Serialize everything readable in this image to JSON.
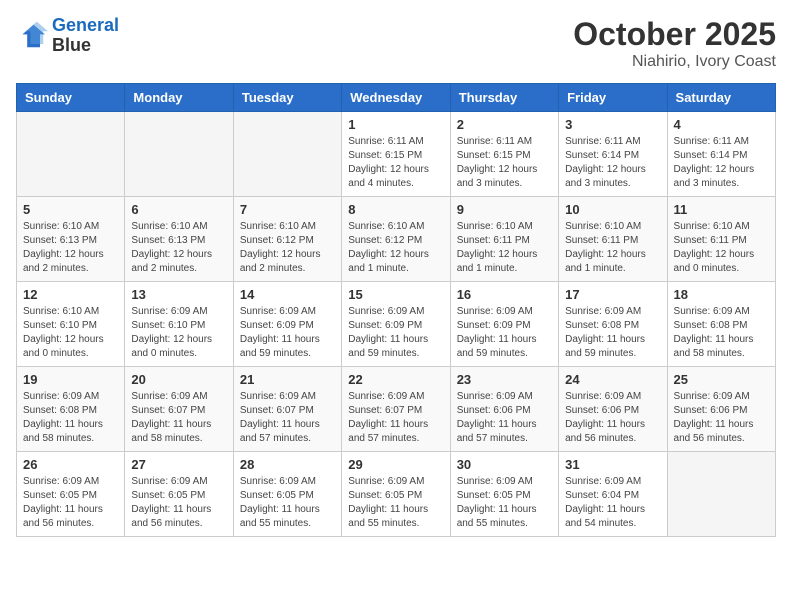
{
  "header": {
    "logo_line1": "General",
    "logo_line2": "Blue",
    "title": "October 2025",
    "subtitle": "Niahirio, Ivory Coast"
  },
  "weekdays": [
    "Sunday",
    "Monday",
    "Tuesday",
    "Wednesday",
    "Thursday",
    "Friday",
    "Saturday"
  ],
  "weeks": [
    [
      {
        "day": "",
        "info": ""
      },
      {
        "day": "",
        "info": ""
      },
      {
        "day": "",
        "info": ""
      },
      {
        "day": "1",
        "info": "Sunrise: 6:11 AM\nSunset: 6:15 PM\nDaylight: 12 hours\nand 4 minutes."
      },
      {
        "day": "2",
        "info": "Sunrise: 6:11 AM\nSunset: 6:15 PM\nDaylight: 12 hours\nand 3 minutes."
      },
      {
        "day": "3",
        "info": "Sunrise: 6:11 AM\nSunset: 6:14 PM\nDaylight: 12 hours\nand 3 minutes."
      },
      {
        "day": "4",
        "info": "Sunrise: 6:11 AM\nSunset: 6:14 PM\nDaylight: 12 hours\nand 3 minutes."
      }
    ],
    [
      {
        "day": "5",
        "info": "Sunrise: 6:10 AM\nSunset: 6:13 PM\nDaylight: 12 hours\nand 2 minutes."
      },
      {
        "day": "6",
        "info": "Sunrise: 6:10 AM\nSunset: 6:13 PM\nDaylight: 12 hours\nand 2 minutes."
      },
      {
        "day": "7",
        "info": "Sunrise: 6:10 AM\nSunset: 6:12 PM\nDaylight: 12 hours\nand 2 minutes."
      },
      {
        "day": "8",
        "info": "Sunrise: 6:10 AM\nSunset: 6:12 PM\nDaylight: 12 hours\nand 1 minute."
      },
      {
        "day": "9",
        "info": "Sunrise: 6:10 AM\nSunset: 6:11 PM\nDaylight: 12 hours\nand 1 minute."
      },
      {
        "day": "10",
        "info": "Sunrise: 6:10 AM\nSunset: 6:11 PM\nDaylight: 12 hours\nand 1 minute."
      },
      {
        "day": "11",
        "info": "Sunrise: 6:10 AM\nSunset: 6:11 PM\nDaylight: 12 hours\nand 0 minutes."
      }
    ],
    [
      {
        "day": "12",
        "info": "Sunrise: 6:10 AM\nSunset: 6:10 PM\nDaylight: 12 hours\nand 0 minutes."
      },
      {
        "day": "13",
        "info": "Sunrise: 6:09 AM\nSunset: 6:10 PM\nDaylight: 12 hours\nand 0 minutes."
      },
      {
        "day": "14",
        "info": "Sunrise: 6:09 AM\nSunset: 6:09 PM\nDaylight: 11 hours\nand 59 minutes."
      },
      {
        "day": "15",
        "info": "Sunrise: 6:09 AM\nSunset: 6:09 PM\nDaylight: 11 hours\nand 59 minutes."
      },
      {
        "day": "16",
        "info": "Sunrise: 6:09 AM\nSunset: 6:09 PM\nDaylight: 11 hours\nand 59 minutes."
      },
      {
        "day": "17",
        "info": "Sunrise: 6:09 AM\nSunset: 6:08 PM\nDaylight: 11 hours\nand 59 minutes."
      },
      {
        "day": "18",
        "info": "Sunrise: 6:09 AM\nSunset: 6:08 PM\nDaylight: 11 hours\nand 58 minutes."
      }
    ],
    [
      {
        "day": "19",
        "info": "Sunrise: 6:09 AM\nSunset: 6:08 PM\nDaylight: 11 hours\nand 58 minutes."
      },
      {
        "day": "20",
        "info": "Sunrise: 6:09 AM\nSunset: 6:07 PM\nDaylight: 11 hours\nand 58 minutes."
      },
      {
        "day": "21",
        "info": "Sunrise: 6:09 AM\nSunset: 6:07 PM\nDaylight: 11 hours\nand 57 minutes."
      },
      {
        "day": "22",
        "info": "Sunrise: 6:09 AM\nSunset: 6:07 PM\nDaylight: 11 hours\nand 57 minutes."
      },
      {
        "day": "23",
        "info": "Sunrise: 6:09 AM\nSunset: 6:06 PM\nDaylight: 11 hours\nand 57 minutes."
      },
      {
        "day": "24",
        "info": "Sunrise: 6:09 AM\nSunset: 6:06 PM\nDaylight: 11 hours\nand 56 minutes."
      },
      {
        "day": "25",
        "info": "Sunrise: 6:09 AM\nSunset: 6:06 PM\nDaylight: 11 hours\nand 56 minutes."
      }
    ],
    [
      {
        "day": "26",
        "info": "Sunrise: 6:09 AM\nSunset: 6:05 PM\nDaylight: 11 hours\nand 56 minutes."
      },
      {
        "day": "27",
        "info": "Sunrise: 6:09 AM\nSunset: 6:05 PM\nDaylight: 11 hours\nand 56 minutes."
      },
      {
        "day": "28",
        "info": "Sunrise: 6:09 AM\nSunset: 6:05 PM\nDaylight: 11 hours\nand 55 minutes."
      },
      {
        "day": "29",
        "info": "Sunrise: 6:09 AM\nSunset: 6:05 PM\nDaylight: 11 hours\nand 55 minutes."
      },
      {
        "day": "30",
        "info": "Sunrise: 6:09 AM\nSunset: 6:05 PM\nDaylight: 11 hours\nand 55 minutes."
      },
      {
        "day": "31",
        "info": "Sunrise: 6:09 AM\nSunset: 6:04 PM\nDaylight: 11 hours\nand 54 minutes."
      },
      {
        "day": "",
        "info": ""
      }
    ]
  ]
}
